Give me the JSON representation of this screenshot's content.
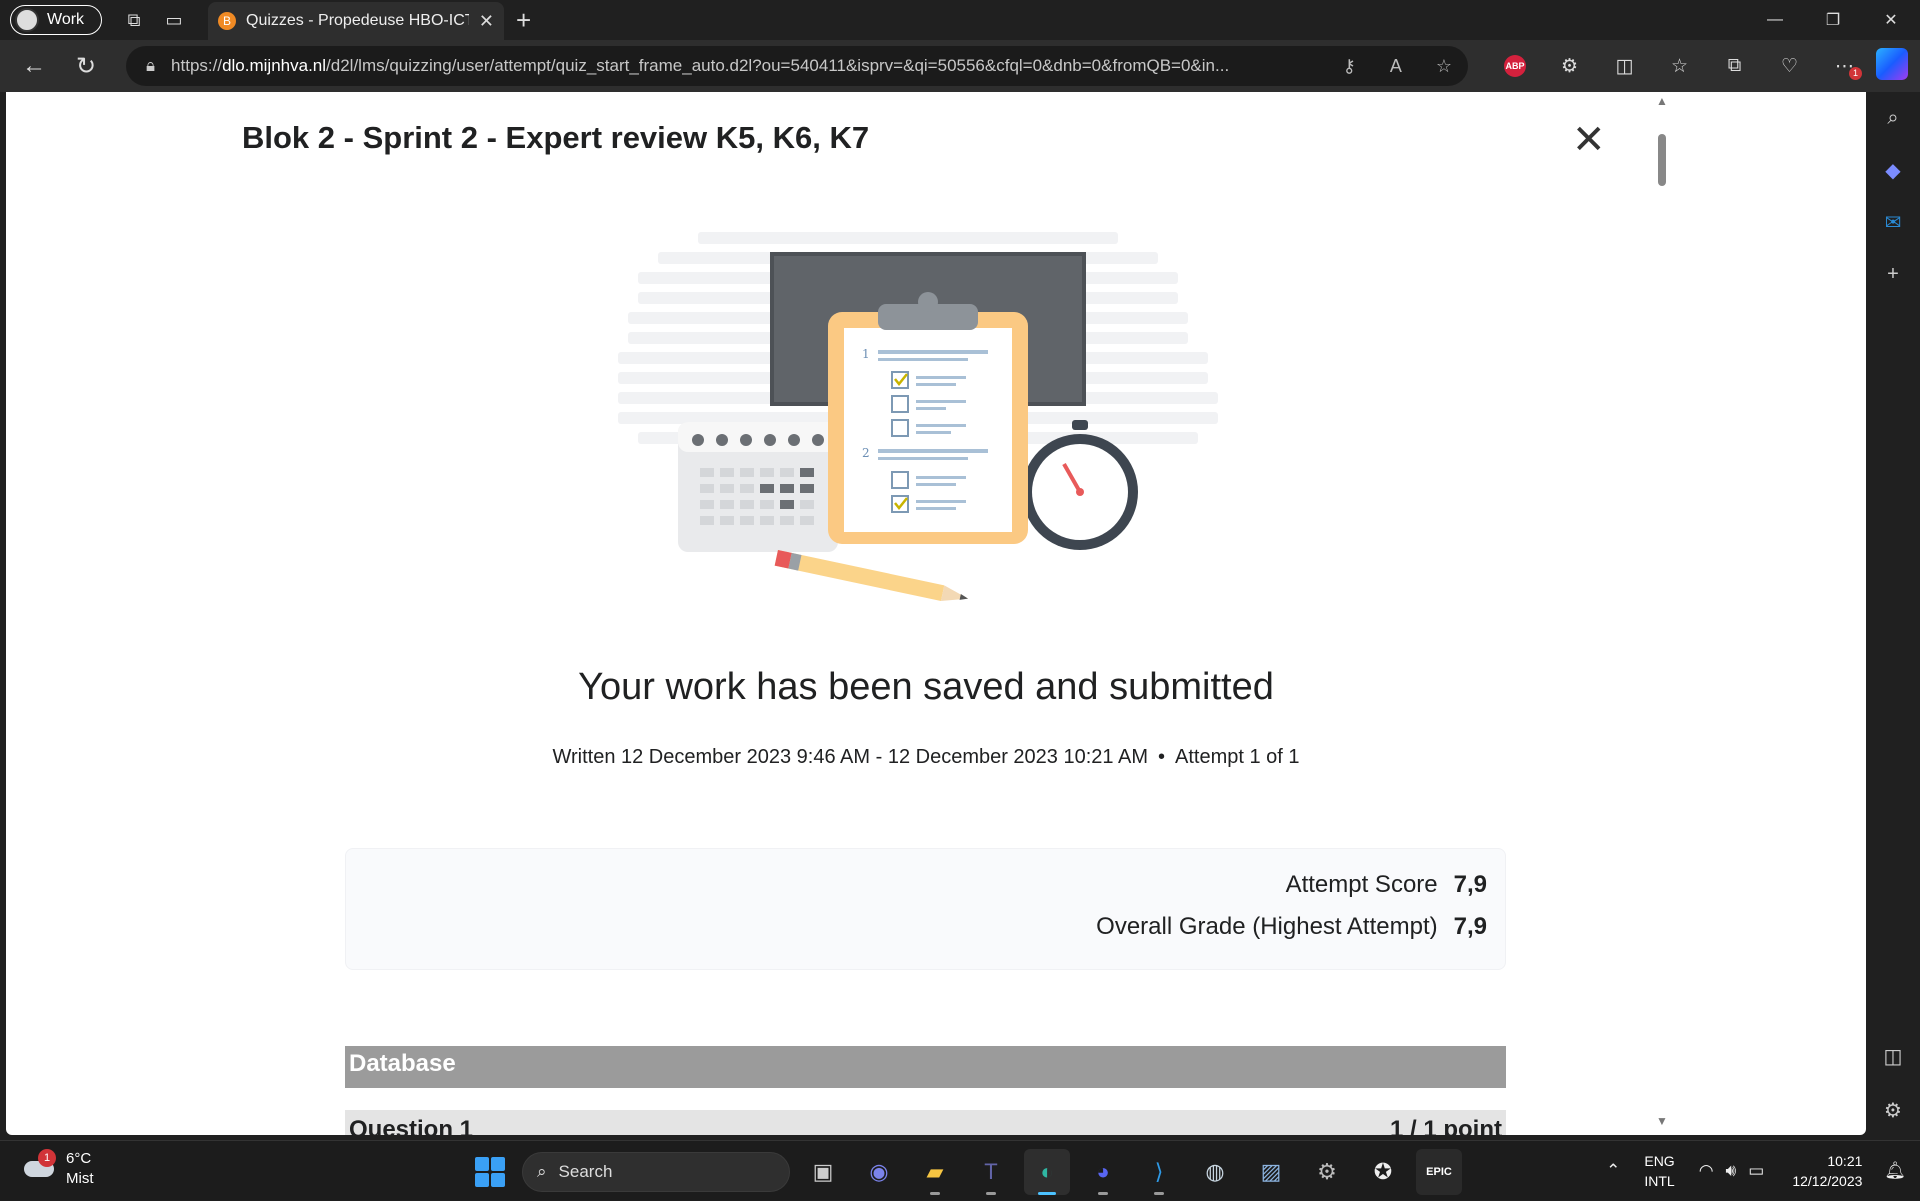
{
  "browser": {
    "profile_label": "Work",
    "tab_title": "Quizzes - Propedeuse HBO-ICT 2",
    "tab_favicon": "B",
    "url_prefix": "https://",
    "url_host": "dlo.mijnhva.nl",
    "url_path": "/d2l/lms/quizzing/user/attempt/quiz_start_frame_auto.d2l?ou=540411&isprv=&qi=50556&cfql=0&dnb=0&fromQB=0&in...",
    "abp_label": "ABP",
    "notif_badge": "1"
  },
  "quiz": {
    "title": "Blok 2 - Sprint 2 - Expert review K5, K6, K7",
    "headline": "Your work has been saved and submitted",
    "written": "Written 12 December 2023 9:46 AM - 12 December 2023 10:21 AM",
    "attempt": "Attempt 1 of 1",
    "scores": [
      {
        "label": "Attempt Score",
        "value": "7,9"
      },
      {
        "label": "Overall Grade (Highest Attempt)",
        "value": "7,9"
      }
    ],
    "section_title": "Database",
    "questions": [
      {
        "label": "Question 1",
        "points": "1 / 1 point"
      }
    ],
    "illustration": {
      "list_num_1": "1",
      "list_num_2": "2"
    }
  },
  "taskbar": {
    "weather_temp": "6°C",
    "weather_desc": "Mist",
    "weather_badge": "1",
    "search_label": "Search",
    "lang_1": "ENG",
    "lang_2": "INTL",
    "time": "10:21",
    "date": "12/12/2023",
    "epic_label": "EPIC"
  },
  "colors": {
    "accent": "#4cc2ff",
    "section_bar": "#9b9b9b",
    "clipboard": "#fbc983"
  }
}
